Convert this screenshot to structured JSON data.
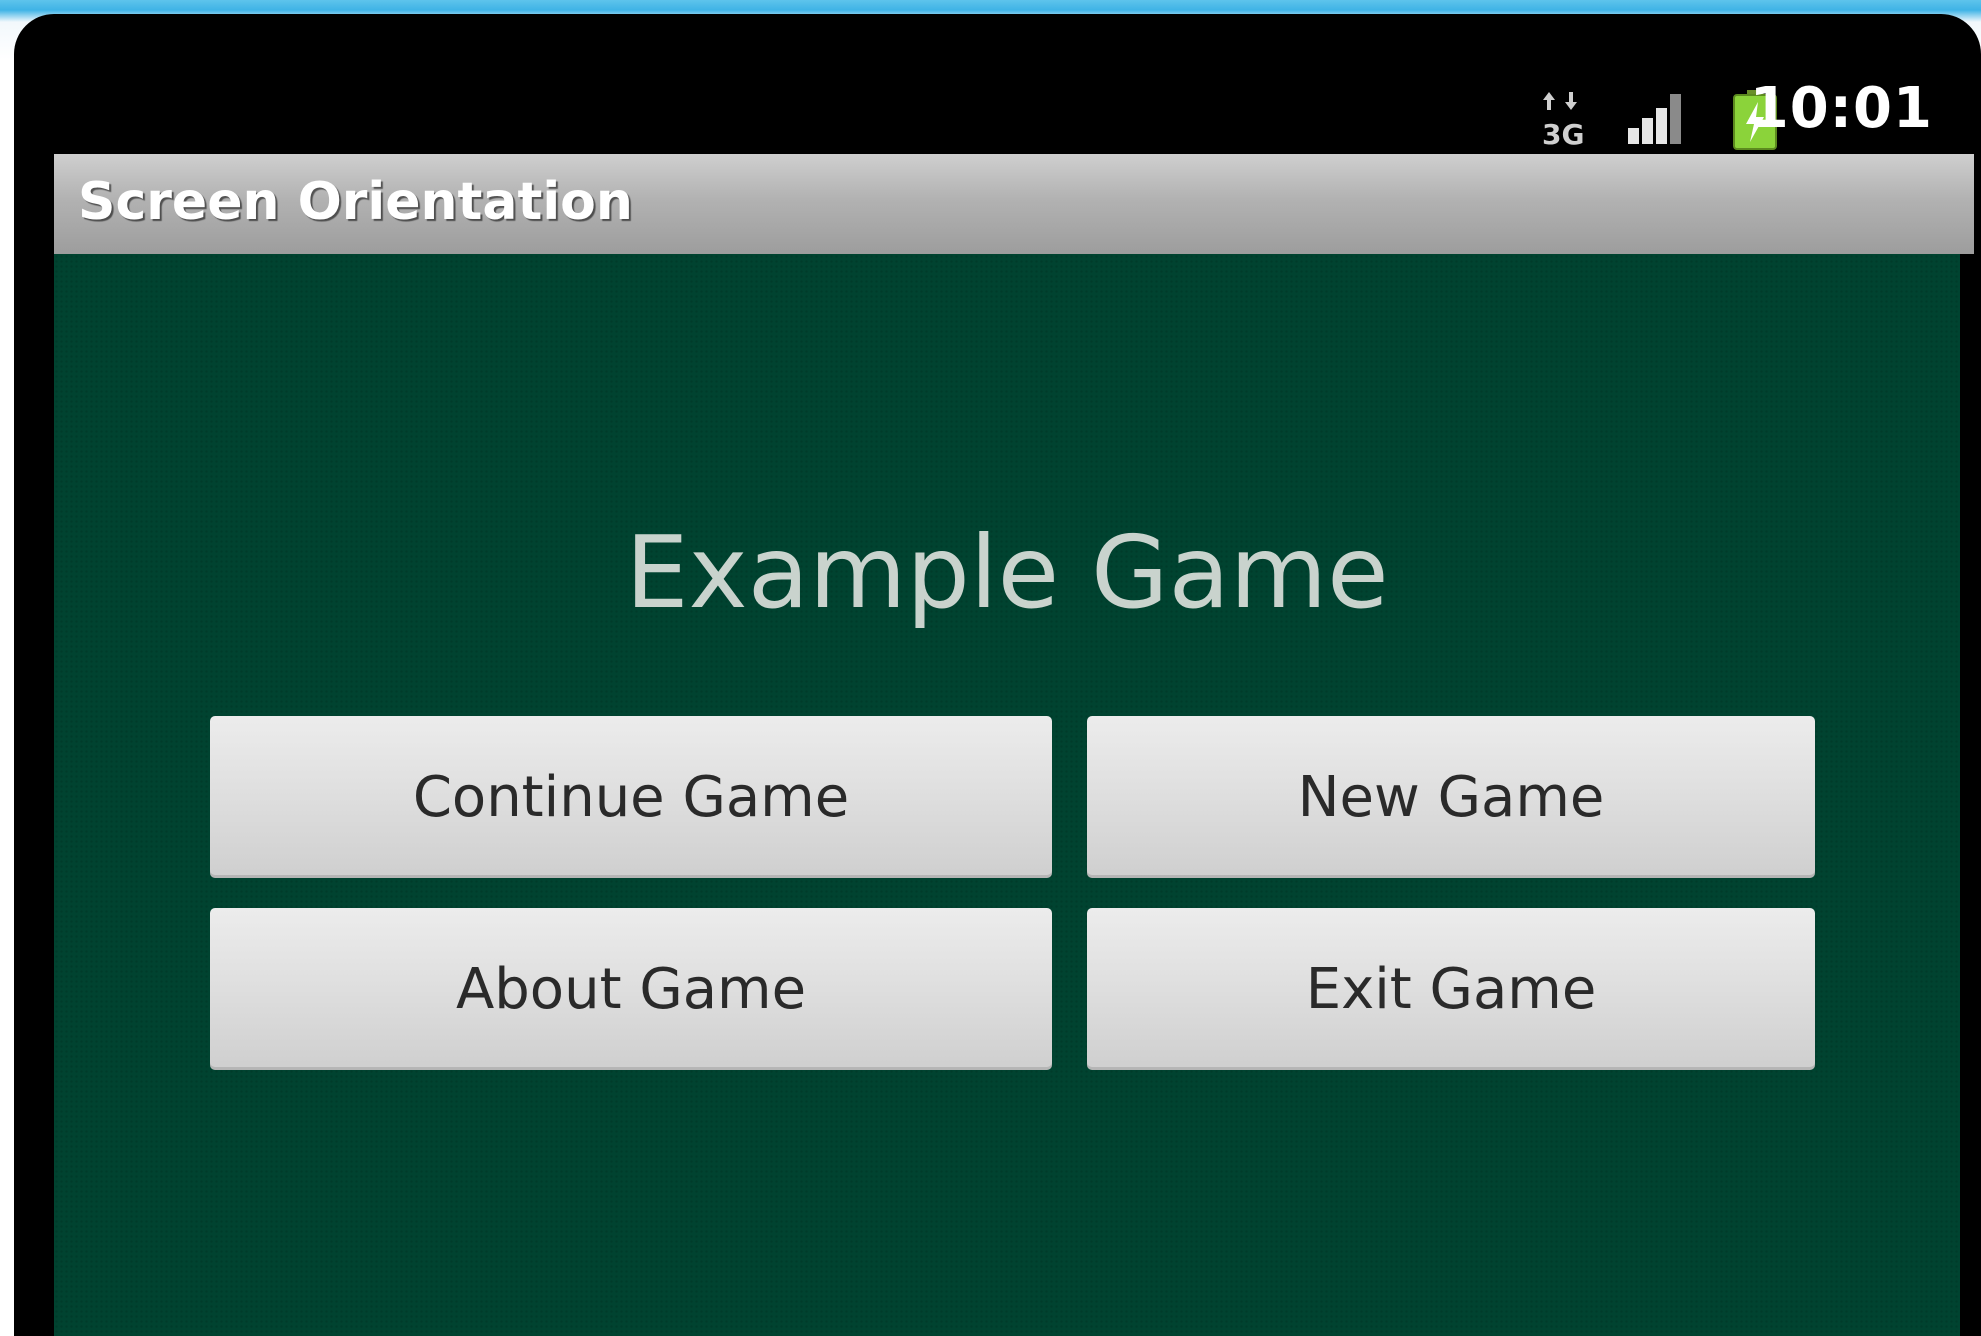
{
  "status_bar": {
    "network_icon": "3g-data-icon",
    "signal_icon": "signal-strength-icon",
    "battery_icon": "battery-charging-icon",
    "time": "10:01"
  },
  "app": {
    "title": "Screen Orientation"
  },
  "main": {
    "heading": "Example Game",
    "buttons": {
      "continue": "Continue Game",
      "new": "New Game",
      "about": "About Game",
      "exit": "Exit Game"
    }
  },
  "colors": {
    "content_background": "#004330",
    "title_bar": "#b2b2b2",
    "battery": "#8bd33a"
  }
}
